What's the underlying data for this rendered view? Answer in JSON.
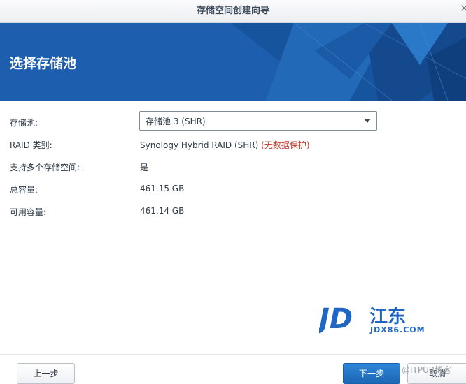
{
  "window": {
    "title": "存储空间创建向导",
    "close_glyph": "×"
  },
  "banner": {
    "heading": "选择存储池"
  },
  "form": {
    "storage_pool": {
      "label": "存储池:",
      "selected": "存储池 3 (SHR)"
    },
    "raid_type": {
      "label": "RAID 类别:",
      "value": "Synology Hybrid RAID (SHR)",
      "warning": "(无数据保护)"
    },
    "multi_volume": {
      "label": "支持多个存储空间:",
      "value": "是"
    },
    "total_capacity": {
      "label": "总容量:",
      "value": "461.15 GB"
    },
    "available_capacity": {
      "label": "可用容量:",
      "value": "461.14 GB"
    }
  },
  "logo": {
    "mark": "JD",
    "name": "江东",
    "domain": "JDX86.COM"
  },
  "footer": {
    "prev_label": "上一步",
    "next_label": "下一步",
    "cancel_label": "取消"
  },
  "watermark": "@ITPUB博客",
  "colors": {
    "banner": "#1d5fae",
    "primary_button": "#1f6cbd",
    "warning": "#c0392b",
    "logo_blue": "#1f66c4"
  }
}
